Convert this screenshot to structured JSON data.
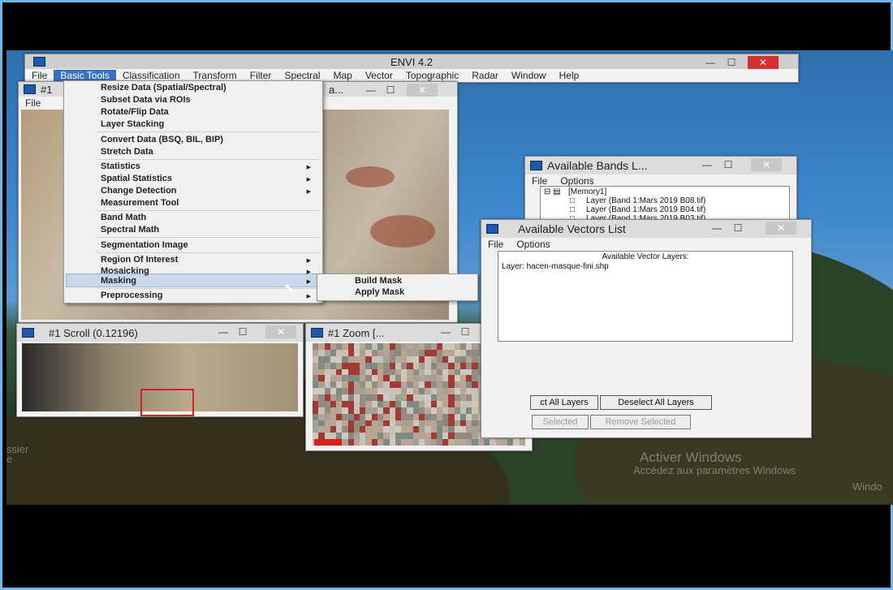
{
  "envi": {
    "title": "ENVI 4.2",
    "menus": [
      "File",
      "Basic Tools",
      "Classification",
      "Transform",
      "Filter",
      "Spectral",
      "Map",
      "Vector",
      "Topographic",
      "Radar",
      "Window",
      "Help"
    ]
  },
  "basic_tools_menu": {
    "items": [
      {
        "label": "Resize Data (Spatial/Spectral)"
      },
      {
        "label": "Subset Data via ROIs"
      },
      {
        "label": "Rotate/Flip Data"
      },
      {
        "label": "Layer Stacking"
      },
      {
        "label": "Convert Data (BSQ, BIL, BIP)"
      },
      {
        "label": "Stretch Data"
      },
      {
        "label": "Statistics"
      },
      {
        "label": "Spatial Statistics"
      },
      {
        "label": "Change Detection"
      },
      {
        "label": "Measurement Tool"
      },
      {
        "label": "Band Math"
      },
      {
        "label": "Spectral Math"
      },
      {
        "label": "Segmentation Image"
      },
      {
        "label": "Region Of Interest"
      },
      {
        "label": "Mosaicking"
      },
      {
        "label": "Masking"
      },
      {
        "label": "Preprocessing"
      }
    ],
    "submenu": [
      "Build Mask",
      "Apply Mask"
    ]
  },
  "image_window": {
    "title": "#1",
    "title_tail": "a...",
    "menu_file": "File"
  },
  "scroll_window": {
    "title": "#1 Scroll (0.12196)"
  },
  "zoom_window": {
    "title": "#1 Zoom [..."
  },
  "bands_window": {
    "title": "Available Bands L...",
    "menus": [
      "File",
      "Options"
    ],
    "root": "[Memory1]",
    "layers": [
      "Layer (Band 1:Mars 2019 B08.tif)",
      "Layer (Band 1:Mars 2019 B04.tif)",
      "Layer (Band 1:Mars 2019 B03.tif)"
    ]
  },
  "vectors_window": {
    "title": "Available Vectors List",
    "menus": [
      "File",
      "Options"
    ],
    "list_header": "Available Vector Layers:",
    "layer": "Layer: hacen-masque-fini.shp",
    "buttons": {
      "select_all": "ct All Layers",
      "deselect_all": "Deselect All Layers",
      "selected": "Selected",
      "remove_selected": "Remove Selected"
    }
  },
  "desktop": {
    "watermark_title": "Activer Windows",
    "watermark_sub": "Accédez aux paramètres Windows",
    "left_label_1": "ssier",
    "left_label_2": "e",
    "right_label": "Windo"
  },
  "colors": {
    "accent": "#3c6fc4",
    "close_red": "#d83030",
    "roi_red": "#d82020",
    "frame_blue": "#6fb6ea"
  }
}
